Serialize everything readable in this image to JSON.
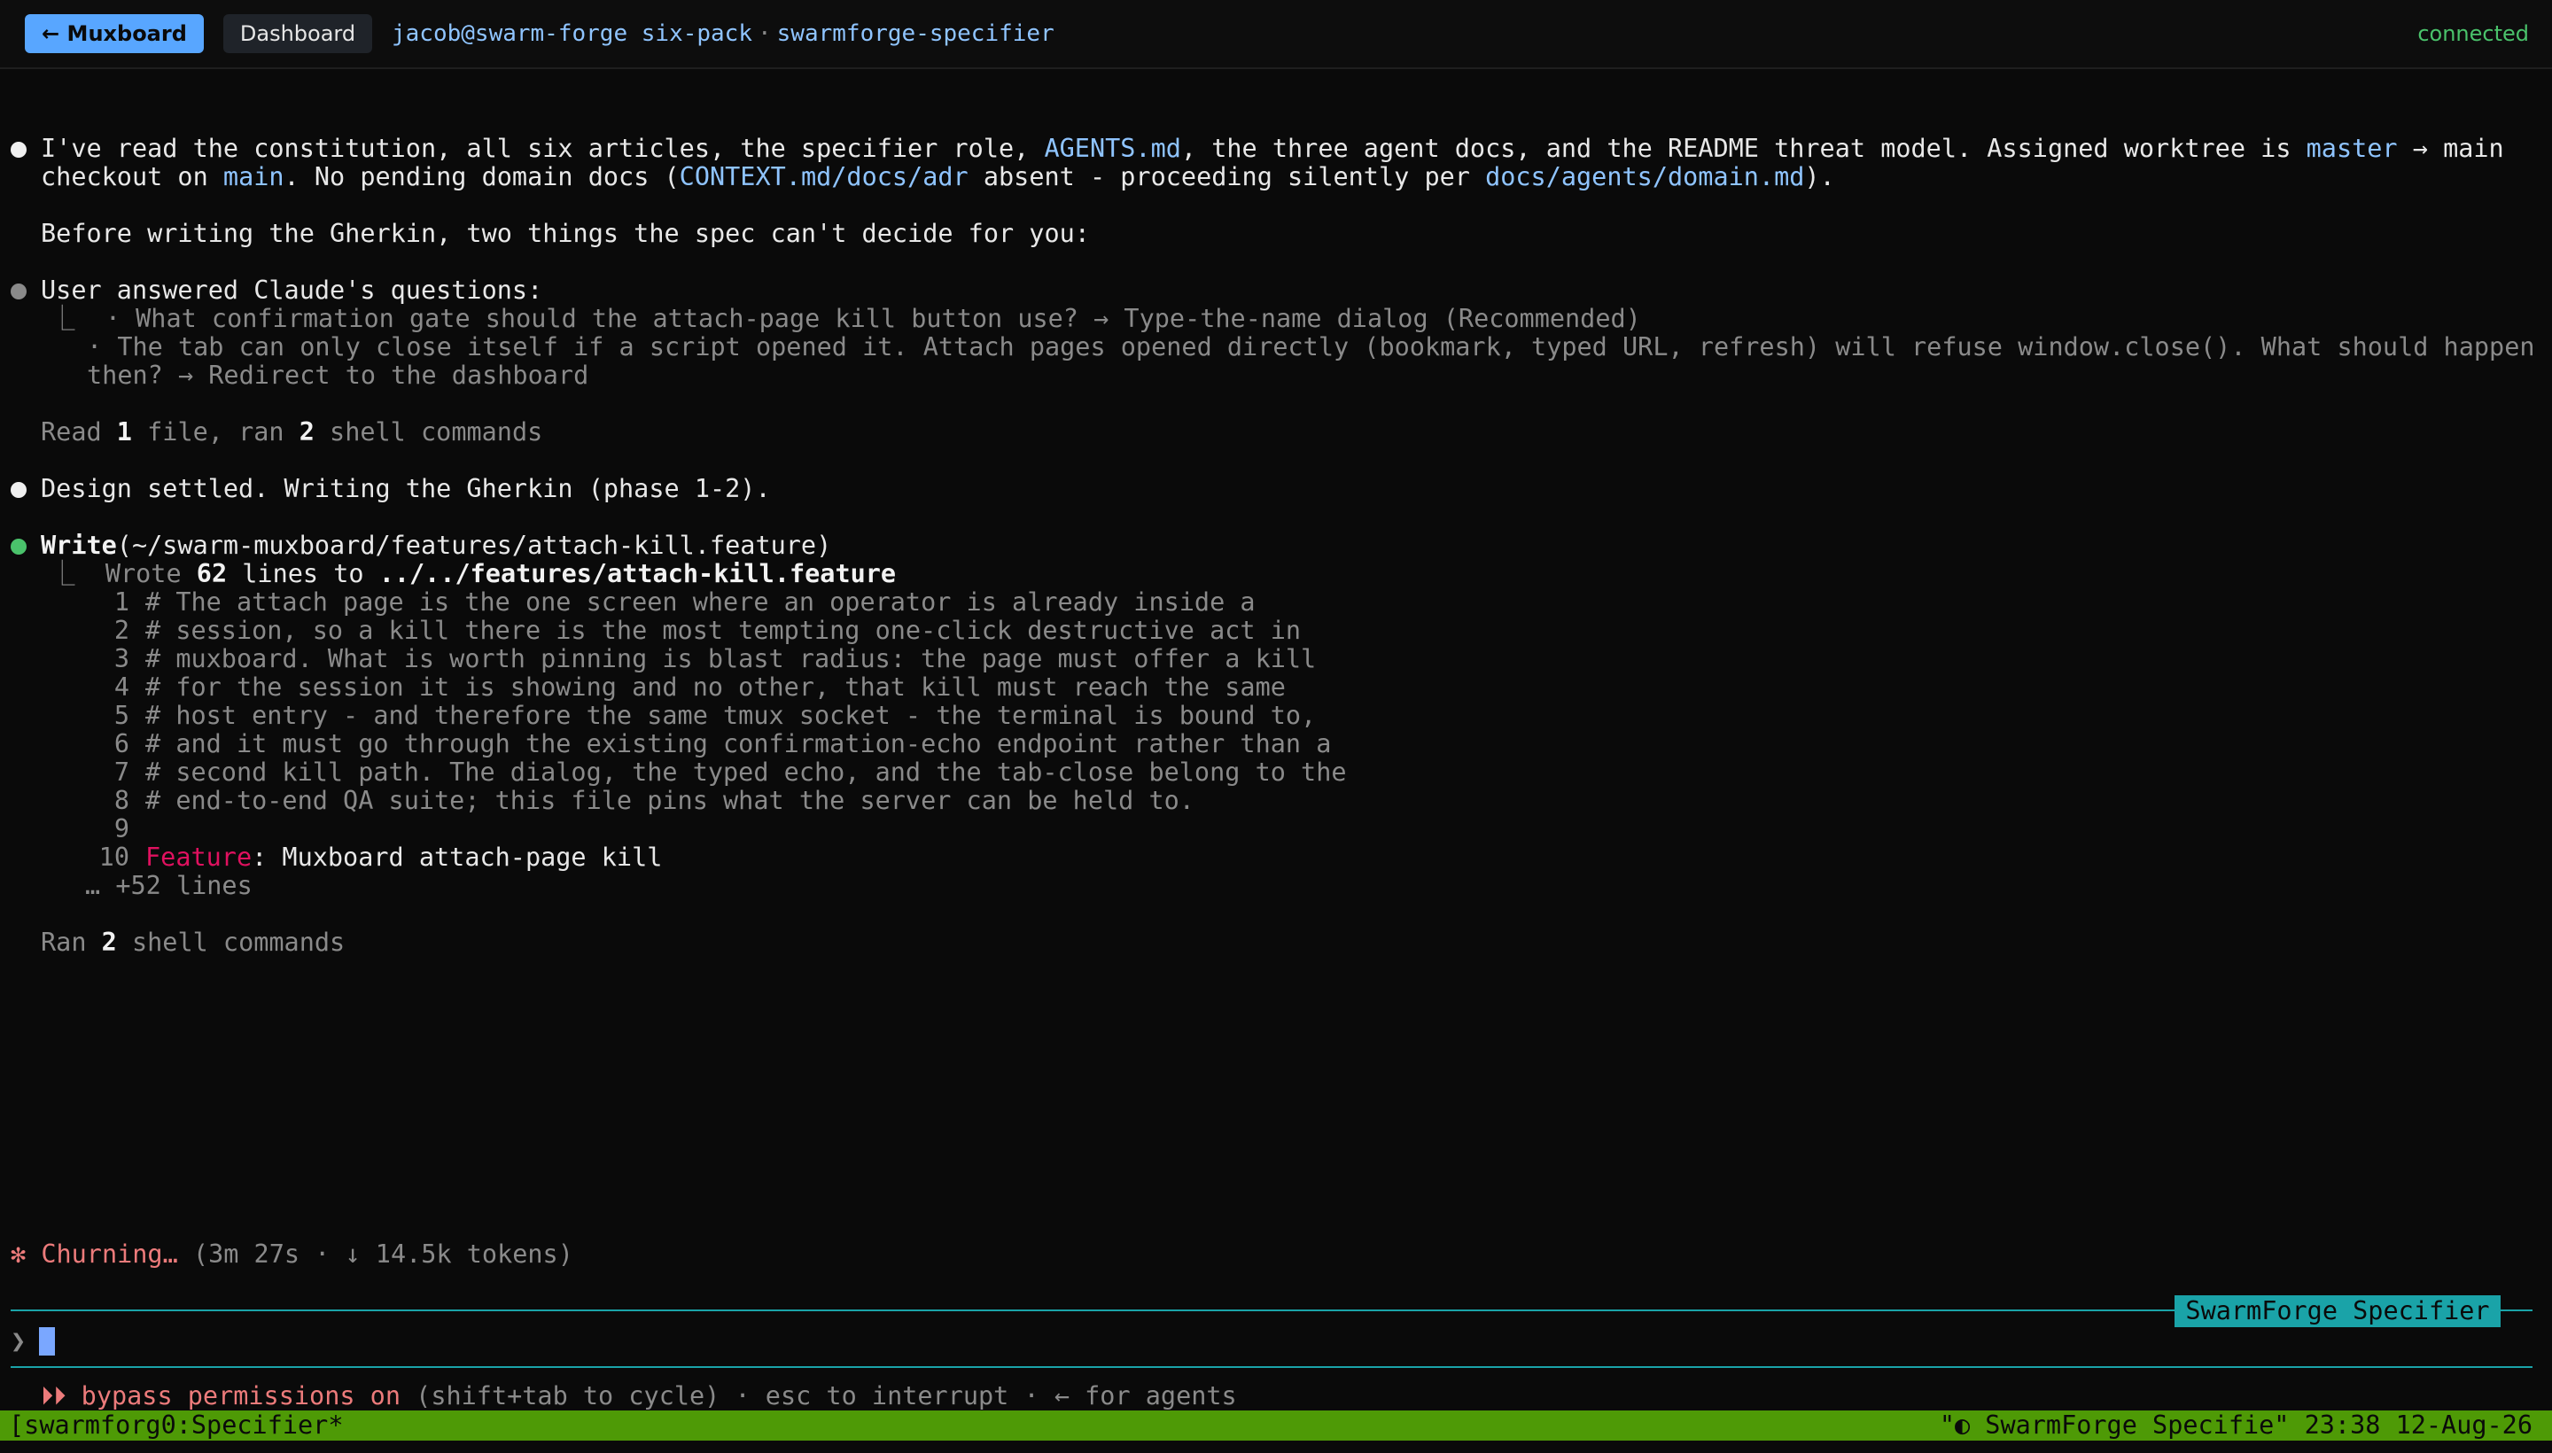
{
  "header": {
    "back_label": "← Muxboard",
    "dashboard_label": "Dashboard",
    "host_session": "jacob@swarm-forge six-pack",
    "separator": "·",
    "pane_name": "swarmforge-specifier",
    "connection_status": "connected"
  },
  "terminal": {
    "msg1": {
      "a": "I've read the constitution, all six articles, the specifier role, ",
      "b": "AGENTS.md",
      "c": ", the three agent docs, and the README threat model. Assigned worktree is ",
      "d": "master",
      "e": " → main",
      "f": "checkout on ",
      "g": "main",
      "h": ". No pending domain docs (",
      "i": "CONTEXT.md/docs/adr",
      "j": " absent - proceeding silently per ",
      "k": "docs/agents/domain.md",
      "l": ")."
    },
    "msg2": "Before writing the Gherkin, two things the spec can't decide for you:",
    "answered": {
      "title": "User answered Claude's questions:",
      "q1": "⎿  · What confirmation gate should the attach-page kill button use? → Type-the-name dialog (Recommended)",
      "q2": "· The tab can only close itself if a script opened it. Attach pages opened directly (bookmark, typed URL, refresh) will refuse window.close(). What should happen",
      "q2b": "then? → Redirect to the dashboard"
    },
    "read_summary": {
      "a": "Read ",
      "b": "1",
      "c": " file, ran ",
      "d": "2",
      "e": " shell commands"
    },
    "settled": "Design settled. Writing the Gherkin (phase 1-2).",
    "write": {
      "tool": "Write",
      "path": "(~/swarm-muxboard/features/attach-kill.feature)",
      "result_a": "⎿  Wrote ",
      "result_b": "62",
      "result_c": " lines to ",
      "result_d": "../../features/attach-kill.feature",
      "lines": [
        {
          "n": "1",
          "t": "# The attach page is the one screen where an operator is already inside a"
        },
        {
          "n": "2",
          "t": "# session, so a kill there is the most tempting one-click destructive act in"
        },
        {
          "n": "3",
          "t": "# muxboard. What is worth pinning is blast radius: the page must offer a kill"
        },
        {
          "n": "4",
          "t": "# for the session it is showing and no other, that kill must reach the same"
        },
        {
          "n": "5",
          "t": "# host entry - and therefore the same tmux socket - the terminal is bound to,"
        },
        {
          "n": "6",
          "t": "# and it must go through the existing confirmation-echo endpoint rather than a"
        },
        {
          "n": "7",
          "t": "# second kill path. The dialog, the typed echo, and the tab-close belong to the"
        },
        {
          "n": "8",
          "t": "# end-to-end QA suite; this file pins what the server can be held to."
        },
        {
          "n": "9",
          "t": ""
        }
      ],
      "line10_num": "10",
      "line10_keyword": "Feature",
      "line10_rest": ": Muxboard attach-page kill",
      "more": "… +52 lines"
    },
    "ran_summary": {
      "a": "Ran ",
      "b": "2",
      "c": " shell commands"
    },
    "spinner": "✻ Churning…",
    "spinner_detail": " (3m 27s · ↓ 14.5k tokens)"
  },
  "input": {
    "agent_label": "SwarmForge Specifier",
    "prompt_symbol": "❯"
  },
  "hints": {
    "arrows": "⏵⏵ bypass permissions on",
    "rest": " (shift+tab to cycle) · esc to interrupt · ← for agents"
  },
  "statusbar": {
    "left": "[swarmforg0:Specifier*",
    "right": "\"◐ SwarmForge Specifie\" 23:38 12-Aug-26"
  },
  "colors": {
    "accent_blue": "#58a6ff",
    "connected_green": "#4ac26b",
    "rule_teal": "#1aa3a8",
    "feature_pink": "#e0115f",
    "status_green": "#4e9a06"
  }
}
